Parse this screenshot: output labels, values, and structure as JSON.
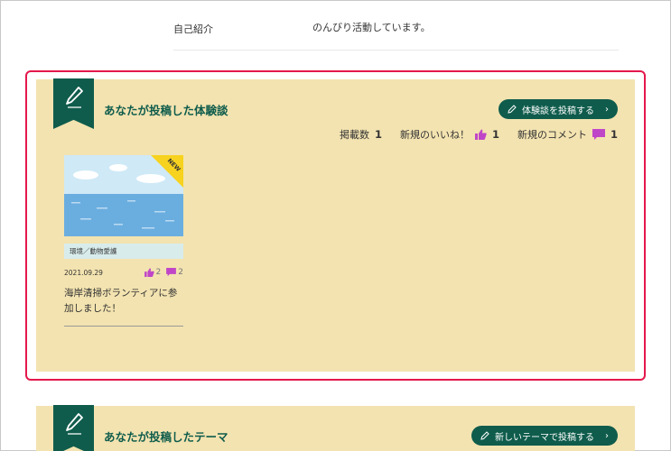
{
  "profile": {
    "label": "自己紹介",
    "value": "のんびり活動しています。"
  },
  "experiences": {
    "title": "あなたが投稿した体験談",
    "button_label": "体験談を投稿する",
    "stats": {
      "posted_label": "掲載数",
      "posted_count": "1",
      "likes_label": "新規のいいね！",
      "likes_count": "1",
      "comments_label": "新規のコメント",
      "comments_count": "1"
    },
    "card": {
      "badge": "NEW",
      "tag": "環境／動物愛護",
      "date": "2021.09.29",
      "likes": "2",
      "comments": "2",
      "title": "海岸清掃ボランティアに参加しました！"
    }
  },
  "themes": {
    "title": "あなたが投稿したテーマ",
    "button_label": "新しいテーマで投稿する"
  },
  "colors": {
    "accent": "#0f5c4c",
    "panel": "#f3e3b0",
    "highlight": "#e4174b",
    "like": "#c046c8"
  }
}
